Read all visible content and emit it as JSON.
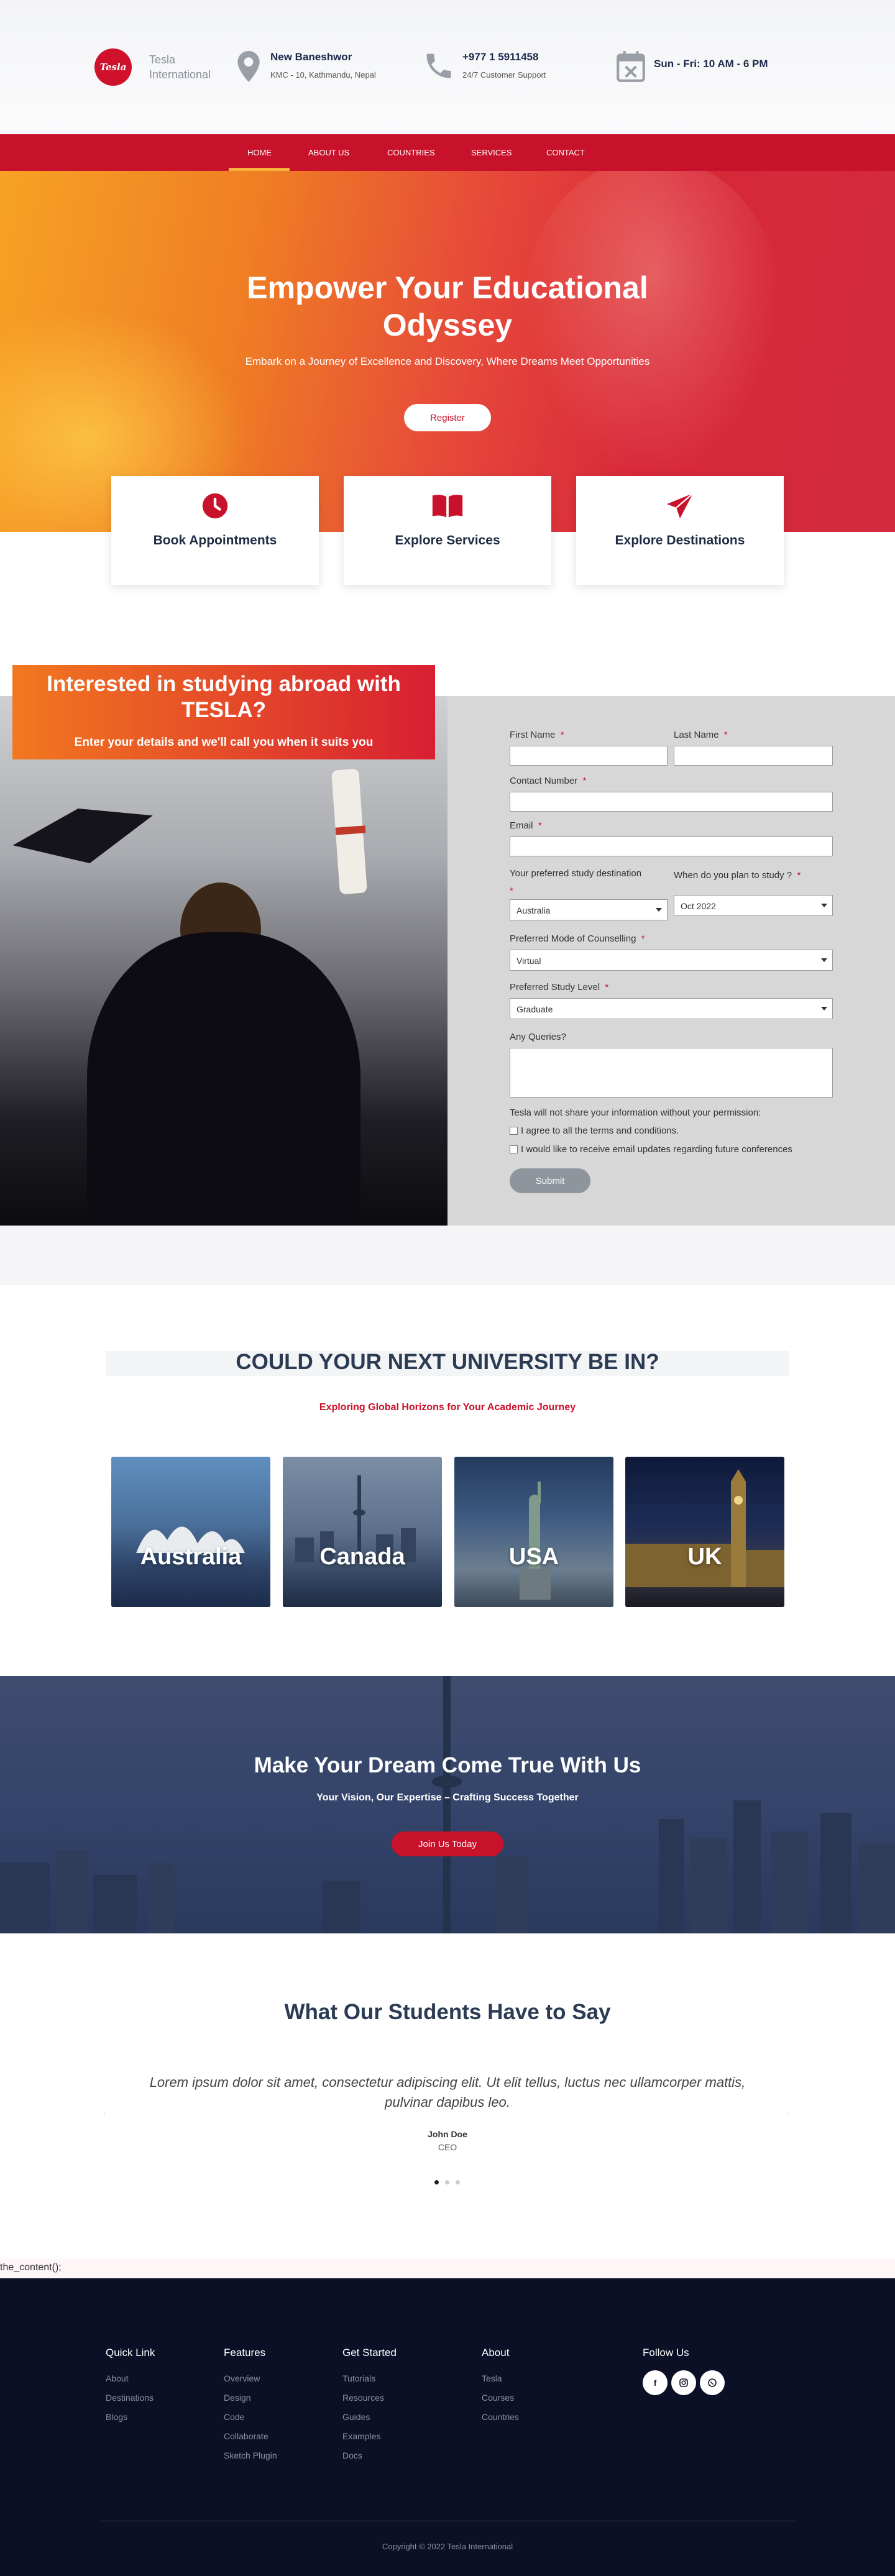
{
  "brand": {
    "logo_text": "Tesla",
    "name_line1": "Tesla",
    "name_line2": "International",
    "accent": "#c8112a"
  },
  "header_info": [
    {
      "icon": "location-pin-icon",
      "title": "New Baneshwor",
      "sub": "KMC - 10, Kathmandu, Nepal"
    },
    {
      "icon": "phone-icon",
      "title": "+977 1 5911458",
      "sub": "24/7 Customer Support"
    },
    {
      "icon": "calendar-icon",
      "title": "Sun - Fri: 10 AM - 6 PM",
      "sub": ""
    }
  ],
  "nav": [
    "Home",
    "About Us",
    "Countries",
    "Services",
    "Contact"
  ],
  "hero": {
    "title_line1": "Empower Your Educational",
    "title_line2": "Odyssey",
    "subtitle": "Embark on a Journey of Excellence and Discovery, Where Dreams Meet Opportunities",
    "button": "Register"
  },
  "cards": [
    {
      "icon": "clock-icon",
      "label": "Book Appointments"
    },
    {
      "icon": "open-book-icon",
      "label": "Explore Services"
    },
    {
      "icon": "paper-plane-icon",
      "label": "Explore Destinations"
    }
  ],
  "interest": {
    "title_line1": "Interested in studying abroad with",
    "title_line2": "TESLA?",
    "subtitle": "Enter your details and we'll call you when it suits you"
  },
  "form": {
    "first_name": "First Name",
    "last_name": "Last Name",
    "contact": "Contact Number",
    "email": "Email",
    "destination_label": "Your preferred study destination",
    "destination_value": "Australia",
    "when_label": "When do you plan to study ?",
    "when_value": "Oct 2022",
    "mode_label": "Preferred Mode of Counselling",
    "mode_value": "Virtual",
    "level_label": "Preferred Study Level",
    "level_value": "Graduate",
    "queries_label": "Any Queries?",
    "privacy": "Tesla will not share your information without your permission:",
    "agree": "I agree to all the terms and conditions.",
    "updates": "I would like to receive email updates regarding future conferences",
    "submit": "Submit",
    "required_mark": "*"
  },
  "universities": {
    "title": "COULD YOUR NEXT UNIVERSITY BE IN?",
    "subtitle": "Exploring Global Horizons for Your Academic Journey",
    "countries": [
      "Australia",
      "Canada",
      "USA",
      "UK"
    ]
  },
  "dream": {
    "title": "Make Your Dream Come True With Us",
    "subtitle": "Your Vision, Our Expertise – Crafting Success Together",
    "button": "Join Us Today"
  },
  "testimonials": {
    "title": "What Our Students Have to Say",
    "quote_line1": "Lorem ipsum dolor sit amet, consectetur adipiscing elit. Ut elit tellus, luctus nec ullamcorper mattis,",
    "quote_line2": "pulvinar dapibus leo.",
    "name": "John Doe",
    "role": "CEO",
    "slide_count": 3,
    "active_slide": 1
  },
  "content_placeholder": "the_content();",
  "footer": {
    "quick_link": {
      "title": "Quick Link",
      "links": [
        "About",
        "Destinations",
        "Blogs"
      ]
    },
    "features": {
      "title": "Features",
      "links": [
        "Overview",
        "Design",
        "Code",
        "Collaborate",
        "Sketch Plugin"
      ]
    },
    "get_started": {
      "title": "Get Started",
      "links": [
        "Tutorials",
        "Resources",
        "Guides",
        "Examples",
        "Docs"
      ]
    },
    "about": {
      "title": "About",
      "links": [
        "Tesla",
        "Courses",
        "Countries"
      ]
    },
    "follow": {
      "title": "Follow Us",
      "icons": [
        "facebook-icon",
        "instagram-icon",
        "viber-icon"
      ]
    },
    "copyright": "Copyright © 2022 Tesla International"
  }
}
